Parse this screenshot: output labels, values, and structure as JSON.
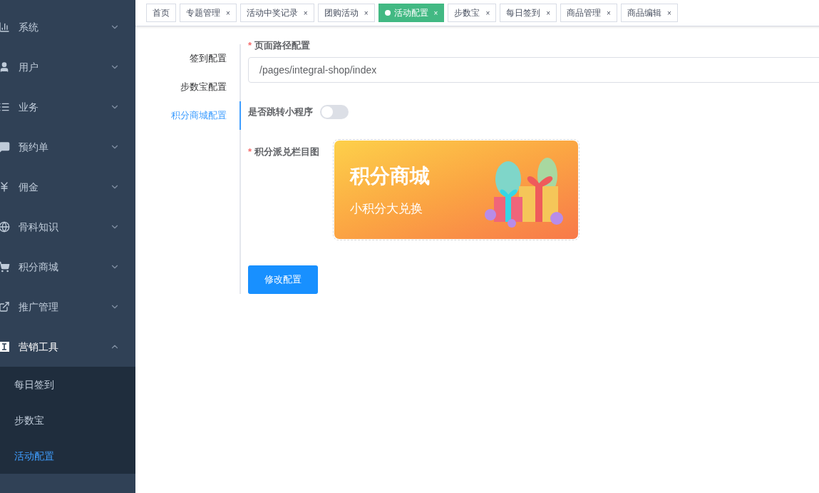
{
  "sidebar": {
    "items": [
      {
        "label": "系统",
        "expanded": false
      },
      {
        "label": "用户",
        "expanded": false
      },
      {
        "label": "业务",
        "expanded": false
      },
      {
        "label": "预约单",
        "expanded": false
      },
      {
        "label": "佣金",
        "expanded": false
      },
      {
        "label": "骨科知识",
        "expanded": false
      },
      {
        "label": "积分商城",
        "expanded": false
      },
      {
        "label": "推广管理",
        "expanded": false
      },
      {
        "label": "营销工具",
        "expanded": true,
        "children": [
          {
            "label": "每日签到",
            "selected": false
          },
          {
            "label": "步数宝",
            "selected": false
          },
          {
            "label": "活动配置",
            "selected": true
          }
        ]
      }
    ]
  },
  "tags": [
    {
      "label": "首页",
      "selected": false
    },
    {
      "label": "专题管理",
      "close": "×",
      "selected": false
    },
    {
      "label": "活动中奖记录",
      "close": "×",
      "selected": false
    },
    {
      "label": "团购活动",
      "close": "×",
      "selected": false
    },
    {
      "label": "活动配置",
      "close": "×",
      "selected": true
    },
    {
      "label": "步数宝",
      "close": "×",
      "selected": false
    },
    {
      "label": "每日签到",
      "close": "×",
      "selected": false
    },
    {
      "label": "商品管理",
      "close": "×",
      "selected": false
    },
    {
      "label": "商品编辑",
      "close": "×",
      "selected": false
    }
  ],
  "config_tabs": [
    {
      "label": "签到配置",
      "selected": false
    },
    {
      "label": "步数宝配置",
      "selected": false
    },
    {
      "label": "积分商城配置",
      "selected": true
    }
  ],
  "form": {
    "path": {
      "label": "页面路径配置",
      "required_mark": "*",
      "value": "/pages/integral-shop/index"
    },
    "jump": {
      "label": "是否跳转小程序",
      "on": false
    },
    "banner": {
      "label": "积分派兑栏目图",
      "required_mark": "*",
      "title": "积分商城",
      "subtitle": "小积分大兑换"
    },
    "submit": "修改配置"
  }
}
